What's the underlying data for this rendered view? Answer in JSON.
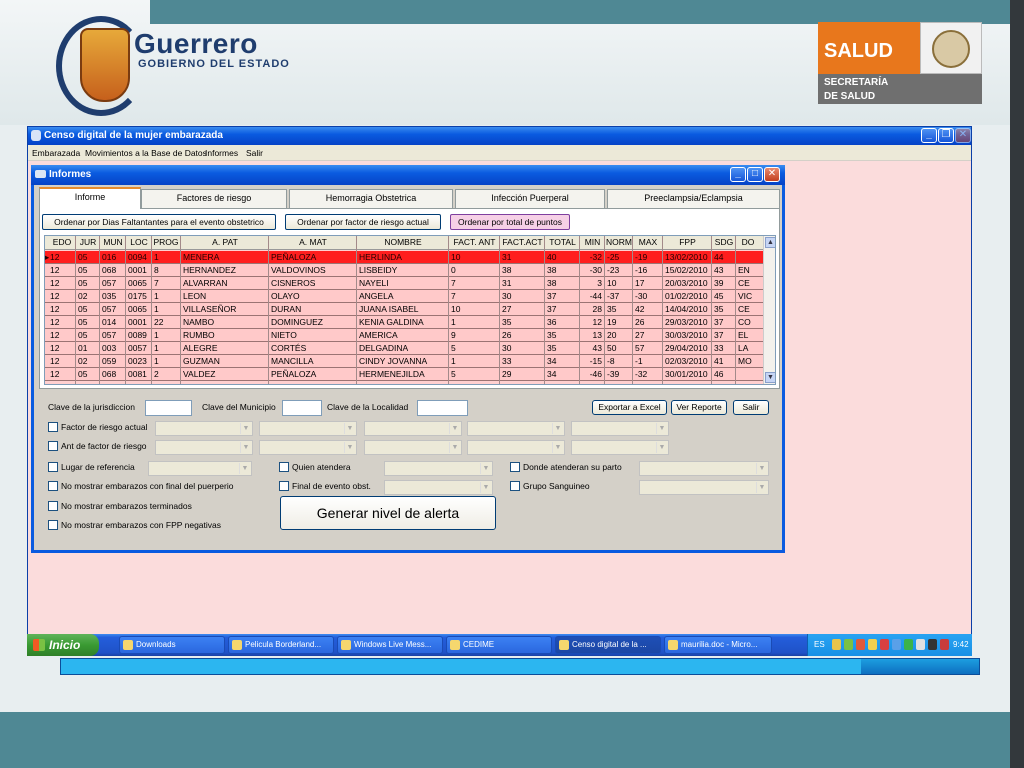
{
  "branding": {
    "guerrero_title": "Guerrero",
    "guerrero_subtitle": "GOBIERNO DEL ESTADO",
    "salud_title": "SALUD",
    "salud_sub_line1": "SECRETARÍA",
    "salud_sub_line2": "DE SALUD"
  },
  "app": {
    "title": "Censo digital de la mujer embarazada",
    "menu": [
      "Embarazada",
      "Movimientos a la Base de Datos",
      "Informes",
      "Salir"
    ]
  },
  "dialog": {
    "title": "Informes",
    "tabs": [
      "Informe",
      "Factores de riesgo",
      "Hemorragia Obstetrica",
      "Infección Puerperal",
      "Preeclampsia/Eclampsia"
    ],
    "order_buttons": [
      "Ordenar por Dias Faltantantes para el evento obstetrico",
      "Ordenar por factor de riesgo actual",
      "Ordenar por total de puntos"
    ],
    "grid": {
      "columns": [
        "EDO",
        "JUR",
        "MUN",
        "LOC",
        "PROG",
        "A. PAT",
        "A. MAT",
        "NOMBRE",
        "FACT. ANT",
        "FACT.ACT",
        "TOTAL",
        "MIN",
        "NORM",
        "MAX",
        "FPP",
        "SDG",
        "DO"
      ],
      "rows": [
        [
          "12",
          "05",
          "016",
          "0094",
          "1",
          "MENERA",
          "PEÑALOZA",
          "HERLINDA",
          "10",
          "31",
          "40",
          "-32",
          "-25",
          "-19",
          "13/02/2010",
          "44",
          ""
        ],
        [
          "12",
          "05",
          "068",
          "0001",
          "8",
          "HERNANDEZ",
          "VALDOVINOS",
          "LISBEIDY",
          "0",
          "38",
          "38",
          "-30",
          "-23",
          "-16",
          "15/02/2010",
          "43",
          "EN"
        ],
        [
          "12",
          "05",
          "057",
          "0065",
          "7",
          "ALVARRAN",
          "CISNEROS",
          "NAYELI",
          "7",
          "31",
          "38",
          "3",
          "10",
          "17",
          "20/03/2010",
          "39",
          "CE"
        ],
        [
          "12",
          "02",
          "035",
          "0175",
          "1",
          "LEON",
          "OLAYO",
          "ANGELA",
          "7",
          "30",
          "37",
          "-44",
          "-37",
          "-30",
          "01/02/2010",
          "45",
          "VIC"
        ],
        [
          "12",
          "05",
          "057",
          "0065",
          "1",
          "VILLASEÑOR",
          "DURAN",
          "JUANA ISABEL",
          "10",
          "27",
          "37",
          "28",
          "35",
          "42",
          "14/04/2010",
          "35",
          "CE"
        ],
        [
          "12",
          "05",
          "014",
          "0001",
          "22",
          "NAMBO",
          "DOMINGUEZ",
          "KENIA GALDINA",
          "1",
          "35",
          "36",
          "12",
          "19",
          "26",
          "29/03/2010",
          "37",
          "CO"
        ],
        [
          "12",
          "05",
          "057",
          "0089",
          "1",
          "RUMBO",
          "NIETO",
          "AMERICA",
          "9",
          "26",
          "35",
          "13",
          "20",
          "27",
          "30/03/2010",
          "37",
          "EL"
        ],
        [
          "12",
          "01",
          "003",
          "0057",
          "1",
          "ALEGRE",
          "CORTÉS",
          "DELGADINA",
          "5",
          "30",
          "35",
          "43",
          "50",
          "57",
          "29/04/2010",
          "33",
          "LA"
        ],
        [
          "12",
          "02",
          "059",
          "0023",
          "1",
          "GUZMAN",
          "MANCILLA",
          "CINDY JOVANNA",
          "1",
          "33",
          "34",
          "-15",
          "-8",
          "-1",
          "02/03/2010",
          "41",
          "MO"
        ],
        [
          "12",
          "05",
          "068",
          "0081",
          "2",
          "VALDEZ",
          "PEÑALOZA",
          "HERMENEJILDA",
          "5",
          "29",
          "34",
          "-46",
          "-39",
          "-32",
          "30/01/2010",
          "46",
          ""
        ]
      ]
    },
    "filters": {
      "clave_jurisdiccion": "Clave de la jurisdiccion",
      "clave_municipio": "Clave del Municipio",
      "clave_localidad": "Clave de la Localidad",
      "export_button": "Exportar a Excel",
      "report_button": "Ver Reporte",
      "exit_button": "Salir",
      "factor_actual": "Factor de riesgo actual",
      "factor_ant": "Ant de factor de riesgo",
      "lugar_referencia": "Lugar de referencia",
      "quien_atendera": "Quien atendera",
      "donde_atenderan": "Donde atenderan su parto",
      "final_puerperio": "No mostrar embarazos con final del puerperio",
      "final_evento": "Final de evento obst.",
      "grupo_sanguineo": "Grupo Sanguineo",
      "terminados": "No mostrar embarazos terminados",
      "fpp_negativas": "No mostrar embarazos con FPP negativas",
      "generate_button": "Generar nivel de alerta"
    }
  },
  "taskbar": {
    "start": "Inicio",
    "tasks": [
      "Downloads",
      "Pelicula Borderland...",
      "Windows Live Mess...",
      "CEDIME",
      "Censo digital de la ...",
      "maurilia.doc - Micro..."
    ],
    "lang": "ES",
    "clock": "9:42"
  },
  "colors": {
    "selected_row": "#ff1e1e",
    "row_bg": "#ffc9c9",
    "window_bg": "#fbdcdc",
    "titlebar": "#0a5be0",
    "salud_orange": "#e8771c"
  }
}
